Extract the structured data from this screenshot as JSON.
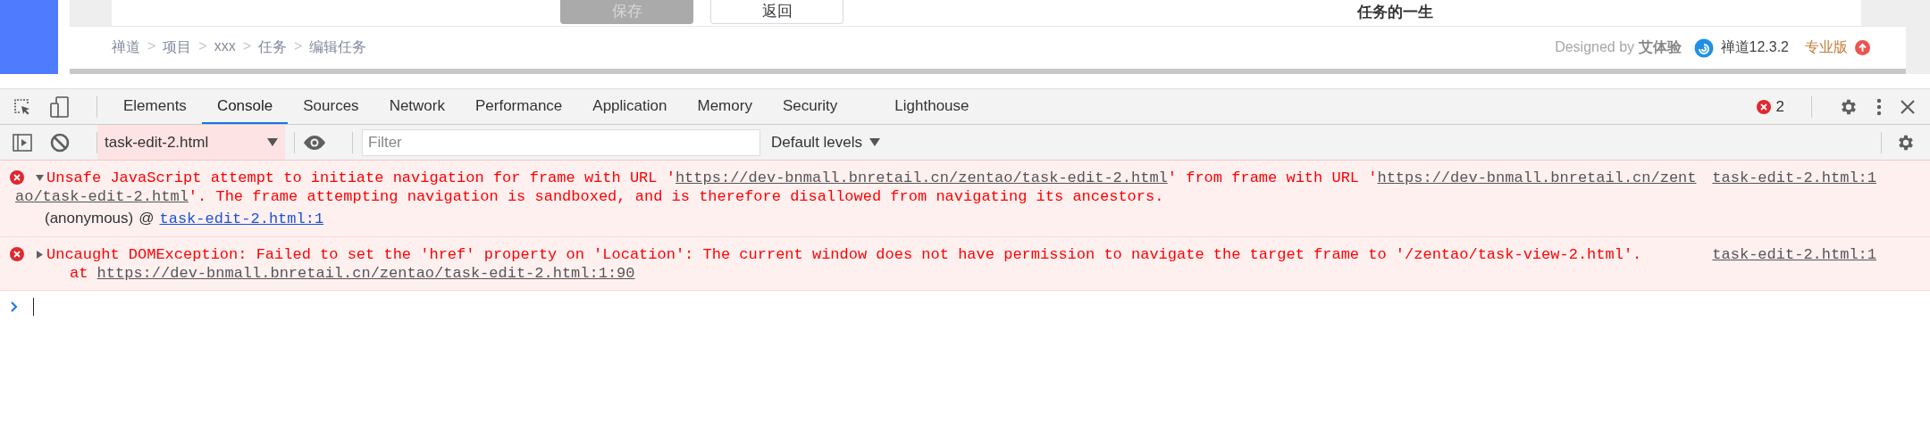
{
  "page": {
    "buttons": [
      {
        "label": "保存",
        "disabled": true
      },
      {
        "label": "返回",
        "disabled": false
      }
    ],
    "section_title": "任务的一生",
    "breadcrumb": {
      "separator": ">",
      "items": [
        "禅道",
        "项目",
        "xxx",
        "任务",
        "编辑任务"
      ]
    },
    "footer": {
      "designed_by": "Designed by **艾体验**",
      "product": "禅道12.3.2",
      "edition": "专业版"
    }
  },
  "devtools": {
    "tabs": [
      {
        "label": "Elements",
        "selected": false
      },
      {
        "label": "Console",
        "selected": true
      },
      {
        "label": "Sources",
        "selected": false
      },
      {
        "label": "Network",
        "selected": false
      },
      {
        "label": "Performance",
        "selected": false
      },
      {
        "label": "Application",
        "selected": false
      },
      {
        "label": "Memory",
        "selected": false
      },
      {
        "label": "Security",
        "selected": false
      },
      {
        "label": "Lighthouse",
        "selected": false
      }
    ],
    "error_count": "2",
    "context": "task-edit-2.html",
    "filter": {
      "placeholder": "Filter"
    },
    "levels": "Default levels",
    "messages": [
      {
        "kind": "error",
        "expanded": true,
        "source": "task-edit-2.html:1",
        "lines": [
          [
            {
              "text": "Unsafe JavaScript attempt to initiate navigation for frame with URL '",
              "link": false
            },
            {
              "text": "https://dev-bnmall.bnretail.cn/zentao/task-edit-2.html",
              "link": true
            },
            {
              "text": "' from frame with URL '",
              "link": false
            },
            {
              "text": "https://dev-bnmall.bnretail.cn/zent",
              "link": true
            }
          ],
          [
            {
              "text": "ao/task-edit-2.html",
              "link": true
            },
            {
              "text": "'. The frame attempting navigation is sandboxed, and is therefore disallowed from navigating its ancestors.",
              "link": false
            }
          ]
        ],
        "stack": [
          {
            "function": "(anonymous)",
            "at": "@",
            "location": "task-edit-2.html:1"
          }
        ]
      },
      {
        "kind": "error",
        "expanded": false,
        "source": "task-edit-2.html:1",
        "lines": [
          [
            {
              "text": "Uncaught DOMException: Failed to set the 'href' property on 'Location': The current window does not have permission to navigate the target frame to '/zentao/task-view-2.html'.",
              "link": false
            }
          ],
          [
            {
              "text": "at ",
              "link": false
            },
            {
              "text": "https://dev-bnmall.bnretail.cn/zentao/task-edit-2.html:1:90",
              "link": true
            }
          ]
        ]
      }
    ]
  }
}
